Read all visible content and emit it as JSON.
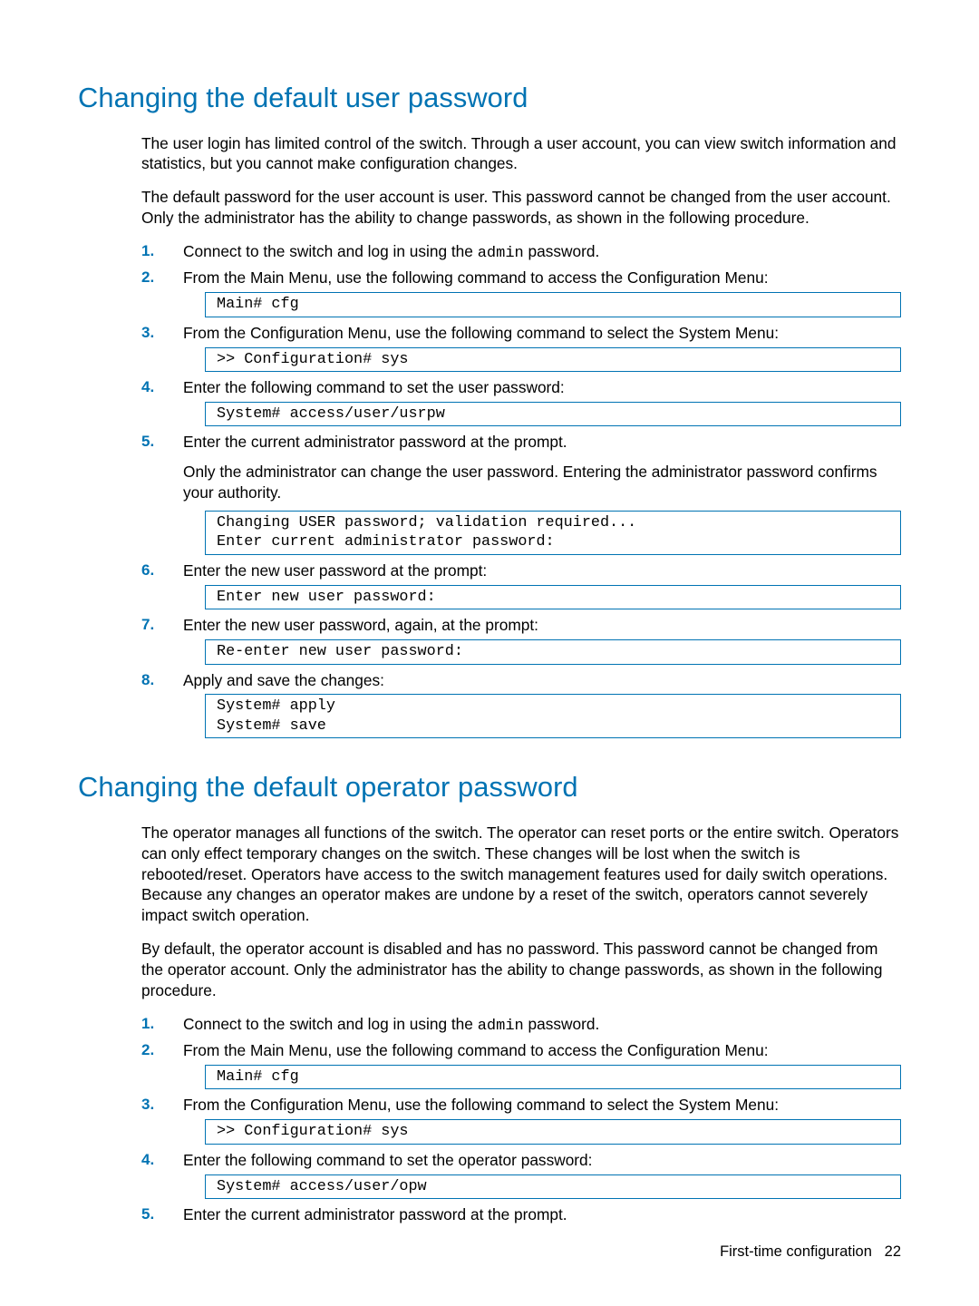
{
  "sections": {
    "user": {
      "heading": "Changing the default user password",
      "para1": "The user login has limited control of the switch. Through a user account, you can view switch information and statistics, but you cannot make configuration changes.",
      "para2": "The default password for the user account is user. This password cannot be changed from the user account. Only the administrator has the ability to change passwords, as shown in the following procedure.",
      "steps": [
        {
          "n": "1.",
          "pre": "Connect to the switch and log in using the ",
          "code_inline": "admin",
          "post": " password."
        },
        {
          "n": "2.",
          "pre": "From the Main Menu, use the following command to access the Configuration Menu:",
          "codebox": "Main# cfg"
        },
        {
          "n": "3.",
          "pre": "From the Configuration Menu, use the following command to select the System Menu:",
          "codebox": ">> Configuration# sys"
        },
        {
          "n": "4.",
          "pre": "Enter the following command to set the user password:",
          "codebox": "System# access/user/usrpw"
        },
        {
          "n": "5.",
          "pre": "Enter the current administrator password at the prompt.",
          "para": "Only the administrator can change the user password. Entering the administrator password confirms your authority.",
          "codebox": "Changing USER password; validation required...\nEnter current administrator password:"
        },
        {
          "n": "6.",
          "pre": "Enter the new user password at the prompt:",
          "codebox": "Enter new user password:"
        },
        {
          "n": "7.",
          "pre": "Enter the new user password, again, at the prompt:",
          "codebox": "Re-enter new user password:"
        },
        {
          "n": "8.",
          "pre": "Apply and save the changes:",
          "codebox": "System# apply\nSystem# save"
        }
      ]
    },
    "operator": {
      "heading": "Changing the default operator password",
      "para1": "The operator manages all functions of the switch. The operator can reset ports or the entire switch. Operators can only effect temporary changes on the switch. These changes will be lost when the switch is rebooted/reset. Operators have access to the switch management features used for daily switch operations. Because any changes an operator makes are undone by a reset of the switch, operators cannot severely impact switch operation.",
      "para2": "By default, the operator account is disabled and has no password. This password cannot be changed from the operator account. Only the administrator has the ability to change passwords, as shown in the following procedure.",
      "steps": [
        {
          "n": "1.",
          "pre": "Connect to the switch and log in using the ",
          "code_inline": "admin",
          "post": " password."
        },
        {
          "n": "2.",
          "pre": "From the Main Menu, use the following command to access the Configuration Menu:",
          "codebox": "Main# cfg"
        },
        {
          "n": "3.",
          "pre": "From the Configuration Menu, use the following command to select the System Menu:",
          "codebox": ">> Configuration# sys"
        },
        {
          "n": "4.",
          "pre": "Enter the following command to set the operator password:",
          "codebox": "System# access/user/opw"
        },
        {
          "n": "5.",
          "pre": "Enter the current administrator password at the prompt."
        }
      ]
    }
  },
  "footer": {
    "label": "First-time configuration",
    "page": "22"
  }
}
